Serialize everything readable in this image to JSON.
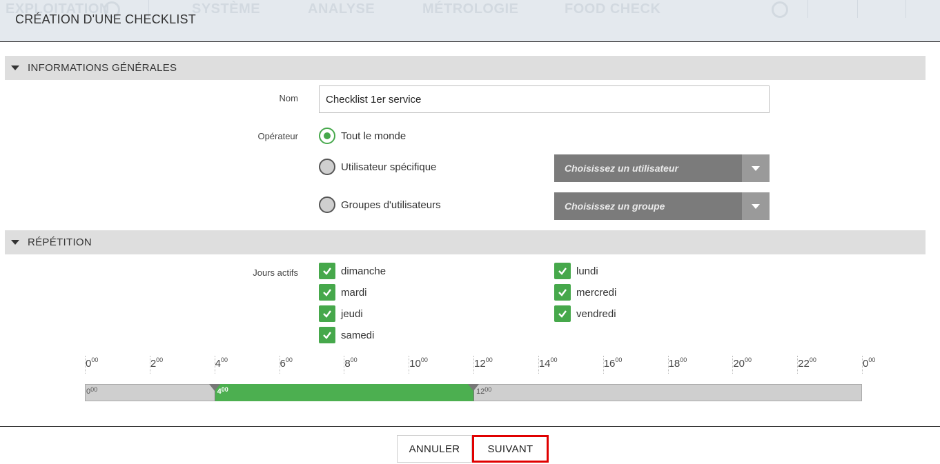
{
  "background_nav": {
    "items": [
      "EXPLOITATION",
      "SYSTÈME",
      "ANALYSE",
      "MÉTROLOGIE",
      "FOOD CHECK"
    ]
  },
  "modal": {
    "title": "CRÉATION D'UNE CHECKLIST"
  },
  "general": {
    "section_label": "INFORMATIONS GÉNÉRALES",
    "name_label": "Nom",
    "name_value": "Checklist 1er service",
    "operator_label": "Opérateur",
    "operator_options": [
      {
        "label": "Tout le monde",
        "checked": true
      },
      {
        "label": "Utilisateur spécifique",
        "checked": false
      },
      {
        "label": "Groupes d'utilisateurs",
        "checked": false
      }
    ],
    "user_dropdown": "Choisissez un utilisateur",
    "group_dropdown": "Choisissez un groupe"
  },
  "repetition": {
    "section_label": "RÉPÉTITION",
    "days_label": "Jours actifs",
    "days": [
      {
        "label": "dimanche",
        "checked": true
      },
      {
        "label": "lundi",
        "checked": true
      },
      {
        "label": "mardi",
        "checked": true
      },
      {
        "label": "mercredi",
        "checked": true
      },
      {
        "label": "jeudi",
        "checked": true
      },
      {
        "label": "vendredi",
        "checked": true
      },
      {
        "label": "samedi",
        "checked": true
      }
    ]
  },
  "timeline": {
    "ticks": [
      {
        "h": "0",
        "m": "00"
      },
      {
        "h": "2",
        "m": "00"
      },
      {
        "h": "4",
        "m": "00"
      },
      {
        "h": "6",
        "m": "00"
      },
      {
        "h": "8",
        "m": "00"
      },
      {
        "h": "10",
        "m": "00"
      },
      {
        "h": "12",
        "m": "00"
      },
      {
        "h": "14",
        "m": "00"
      },
      {
        "h": "16",
        "m": "00"
      },
      {
        "h": "18",
        "m": "00"
      },
      {
        "h": "20",
        "m": "00"
      },
      {
        "h": "22",
        "m": "00"
      },
      {
        "h": "0",
        "m": "00"
      }
    ],
    "start": {
      "h": "4",
      "m": "00"
    },
    "end": {
      "h": "12",
      "m": "00"
    },
    "min": {
      "h": "0",
      "m": "00"
    },
    "range_color": "#4caf50"
  },
  "footer": {
    "cancel_label": "ANNULER",
    "next_label": "SUIVANT",
    "highlight_color": "#e00000"
  }
}
